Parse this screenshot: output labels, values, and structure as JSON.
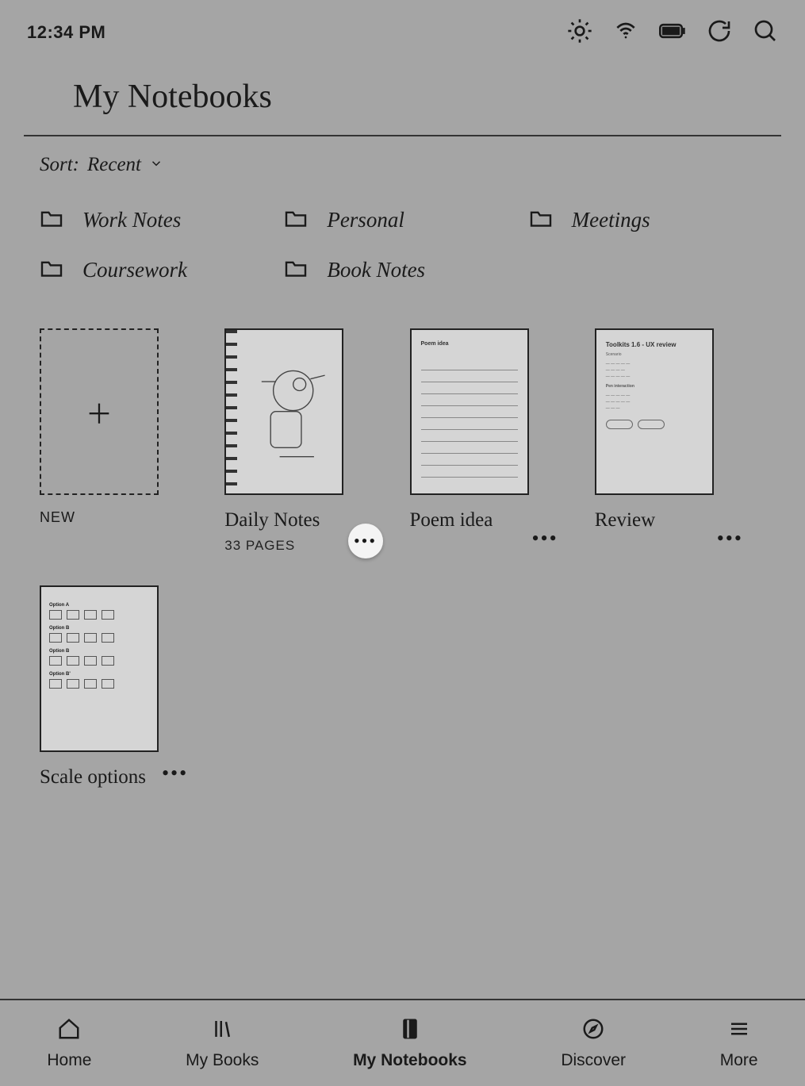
{
  "status": {
    "time": "12:34 PM"
  },
  "page": {
    "title": "My Notebooks"
  },
  "sort": {
    "prefix": "Sort: ",
    "value": "Recent"
  },
  "folders": [
    {
      "label": "Work Notes"
    },
    {
      "label": "Personal"
    },
    {
      "label": "Meetings"
    },
    {
      "label": "Coursework"
    },
    {
      "label": "Book Notes"
    }
  ],
  "new_tile": {
    "label": "NEW"
  },
  "notebooks": [
    {
      "title": "Daily Notes",
      "subtitle": "33 PAGES",
      "highlighted_more": true,
      "thumb": "sketch"
    },
    {
      "title": "Poem idea",
      "subtitle": "",
      "highlighted_more": false,
      "thumb": "lined",
      "thumb_header": "Poem idea"
    },
    {
      "title": "Review",
      "subtitle": "",
      "highlighted_more": false,
      "thumb": "ux",
      "thumb_header": "Toolkits 1.6 - UX review"
    },
    {
      "title": "Scale options",
      "subtitle": "",
      "highlighted_more": false,
      "thumb": "boxes"
    }
  ],
  "thumb_extra": {
    "ux_sections": [
      "Scenario",
      "Pen interaction"
    ],
    "box_labels": [
      "Option A",
      "Option B",
      "Option B",
      "Option B'"
    ]
  },
  "nav": [
    {
      "label": "Home",
      "icon": "home",
      "active": false
    },
    {
      "label": "My Books",
      "icon": "books",
      "active": false
    },
    {
      "label": "My Notebooks",
      "icon": "notebooks",
      "active": true
    },
    {
      "label": "Discover",
      "icon": "compass",
      "active": false
    },
    {
      "label": "More",
      "icon": "menu",
      "active": false
    }
  ]
}
